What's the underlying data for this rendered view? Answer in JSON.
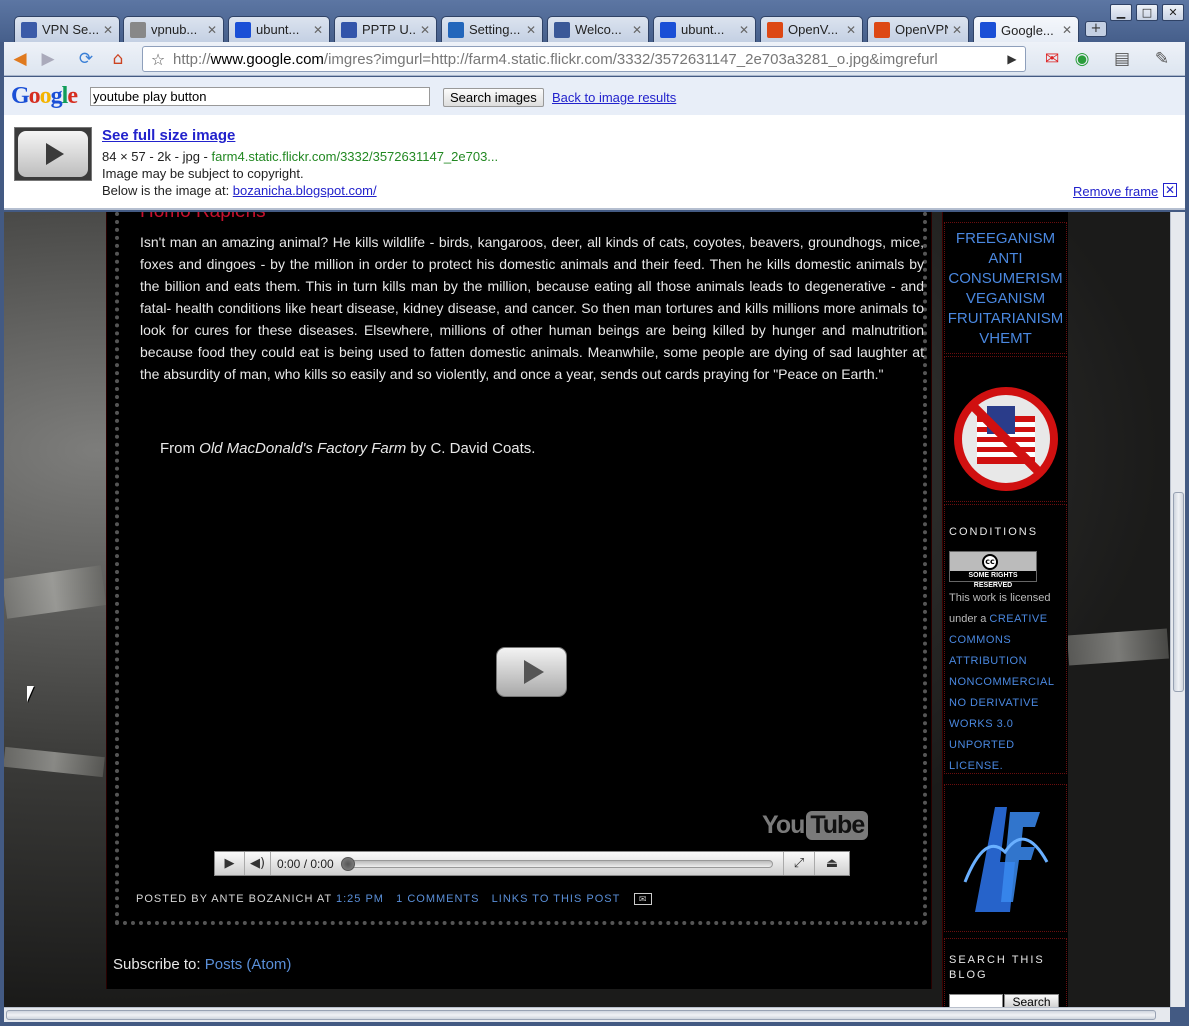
{
  "tabs": [
    {
      "title": "VPN Se...",
      "icon": "ubuntu-forums-icon",
      "color": "#3b5ba8"
    },
    {
      "title": "vpnub...",
      "icon": "document-icon",
      "color": "#888888"
    },
    {
      "title": "ubunt...",
      "icon": "google-icon",
      "color": "#1a4fd6"
    },
    {
      "title": "PPTP U...",
      "icon": "globe-icon",
      "color": "#3355aa"
    },
    {
      "title": "Setting...",
      "icon": "settings-page-icon",
      "color": "#2266bb"
    },
    {
      "title": "Welco...",
      "icon": "facebook-icon",
      "color": "#3b5998"
    },
    {
      "title": "ubunt...",
      "icon": "google-icon",
      "color": "#1a4fd6"
    },
    {
      "title": "OpenV...",
      "icon": "ubuntu-icon",
      "color": "#dd4814"
    },
    {
      "title": "OpenVPN",
      "icon": "ubuntu-icon",
      "color": "#dd4814"
    },
    {
      "title": "Google...",
      "icon": "google-icon",
      "color": "#1a4fd6"
    }
  ],
  "toolbar": {
    "url_prefix": "http://",
    "url_host": "www.google.com",
    "url_path": "/imgres?imgurl=http://farm4.static.flickr.com/3332/3572631147_2e703a3281_o.jpg&imgrefurl"
  },
  "google_bar": {
    "logo": [
      "G",
      "o",
      "o",
      "g",
      "l",
      "e"
    ],
    "query": "youtube play button",
    "search_button": "Search images",
    "back_link": "Back to image results",
    "full_size_link": "See full size image",
    "dimensions": "84 × 57 - 2k - jpg - ",
    "source_url": "farm4.static.flickr.com/3332/3572631147_2e703...",
    "copyright": "Image may be subject to copyright.",
    "below_text": "Below is the image at: ",
    "below_link": "bozanicha.blogspot.com/",
    "remove_frame": "Remove frame"
  },
  "post": {
    "title": "Homo Rapiens",
    "body": "Isn't man an amazing animal? He kills wildlife - birds, kangaroos, deer, all kinds of cats, coyotes, beavers, groundhogs, mice, foxes and dingoes - by the million in order to protect his domestic animals and their feed. Then he kills domestic animals by the billion and eats them. This in turn kills man by the million, because eating all those animals leads to degenerative - and fatal- health conditions like heart disease, kidney disease, and cancer. So then man tortures and kills millions more animals to look for cures for these diseases. Elsewhere, millions of other human beings are being killed by hunger and malnutrition because food they could eat is being used to fatten domestic animals. Meanwhile, some people are dying of sad laughter at the absurdity of man, who kills so easily and so violently, and once a year, sends out cards praying for \"Peace on Earth.\"",
    "quote_prefix": "From ",
    "quote_book": "Old MacDonald's Factory Farm",
    "quote_suffix": " by C. David Coats.",
    "video_time": "0:00 / 0:00",
    "video_progress": 0,
    "yt_logo_you": "You",
    "yt_logo_tube": "Tube",
    "footer_posted_by": "POSTED BY ANTE BOZANICH AT ",
    "footer_time": "1:25 PM",
    "footer_comments": "1 COMMENTS",
    "footer_links": "LINKS TO THIS POST",
    "subscribe_prefix": "Subscribe to: ",
    "subscribe_link": "Posts (Atom)"
  },
  "sidebar": {
    "links": [
      "FREEGANISM",
      "ANTI",
      "CONSUMERISM",
      "VEGANISM",
      "FRUITARIANISM",
      "VHEMT"
    ],
    "conditions_title": "CONDITIONS",
    "cc_badge": "SOME RIGHTS RESERVED",
    "license_text": "This work is licensed under a ",
    "license_link": "Creative Commons Attribution Noncommercial No Derivative Works 3.0 Unported License.",
    "search_title": "SEARCH THIS BLOG",
    "search_button": "Search"
  },
  "colors": {
    "link_blue": "#2222cc",
    "blog_link": "#4a88e0",
    "title_red": "#c8102e",
    "url_green": "#228822"
  }
}
